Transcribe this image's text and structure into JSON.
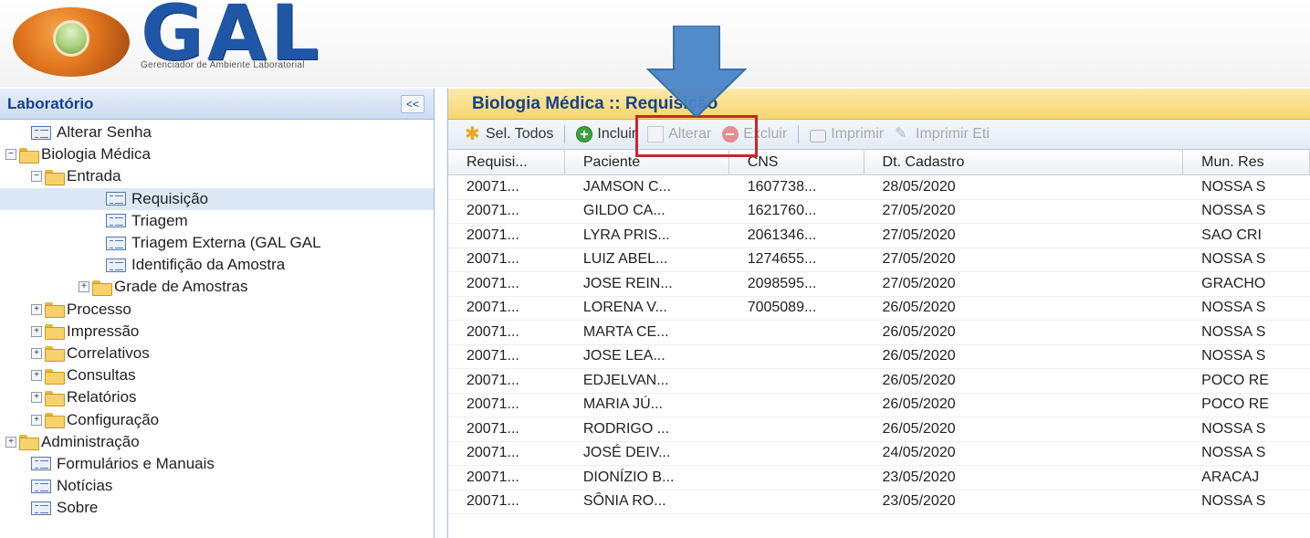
{
  "app": {
    "logo_text": "GAL",
    "logo_subtitle": "Gerenciador de Ambiente Laboratorial"
  },
  "sidebar": {
    "title": "Laboratório",
    "collapse_label": "<<",
    "items": [
      {
        "label": "Alterar Senha",
        "level": 1,
        "type": "leaf"
      },
      {
        "label": "Biologia Médica",
        "level": 0,
        "type": "folder",
        "expanded": true
      },
      {
        "label": "Entrada",
        "level": 1,
        "type": "folder",
        "expanded": true
      },
      {
        "label": "Requisição",
        "level": 3,
        "type": "leaf",
        "selected": true
      },
      {
        "label": "Triagem",
        "level": 3,
        "type": "leaf"
      },
      {
        "label": "Triagem Externa (GAL GAL",
        "level": 3,
        "type": "leaf"
      },
      {
        "label": "Identifição da Amostra",
        "level": 3,
        "type": "leaf"
      },
      {
        "label": "Grade de Amostras",
        "level": 2,
        "type": "folder"
      },
      {
        "label": "Processo",
        "level": 1,
        "type": "folder"
      },
      {
        "label": "Impressão",
        "level": 1,
        "type": "folder"
      },
      {
        "label": "Correlativos",
        "level": 1,
        "type": "folder"
      },
      {
        "label": "Consultas",
        "level": 1,
        "type": "folder"
      },
      {
        "label": "Relatórios",
        "level": 1,
        "type": "folder"
      },
      {
        "label": "Configuração",
        "level": 1,
        "type": "folder"
      },
      {
        "label": "Administração",
        "level": 0,
        "type": "folder"
      },
      {
        "label": "Formulários e Manuais",
        "level": 1,
        "type": "leaf"
      },
      {
        "label": "Notícias",
        "level": 1,
        "type": "leaf"
      },
      {
        "label": "Sobre",
        "level": 1,
        "type": "leaf"
      }
    ]
  },
  "main": {
    "title": "Biologia Médica :: Requisição",
    "toolbar": {
      "select_all": "Sel. Todos",
      "include": "Incluir",
      "edit": "Alterar",
      "delete": "Excluir",
      "print": "Imprimir",
      "print_label": "Imprimir Eti"
    },
    "grid": {
      "columns": [
        "Requisi...",
        "Paciente",
        "CNS",
        "Dt. Cadastro",
        "Mun. Res"
      ],
      "rows": [
        [
          "20071...",
          "JAMSON C...",
          "1607738...",
          "28/05/2020",
          "NOSSA S"
        ],
        [
          "20071...",
          "GILDO CA...",
          "1621760...",
          "27/05/2020",
          "NOSSA S"
        ],
        [
          "20071...",
          "LYRA PRIS...",
          "2061346...",
          "27/05/2020",
          "SAO CRI"
        ],
        [
          "20071...",
          "LUIZ ABEL...",
          "1274655...",
          "27/05/2020",
          "NOSSA S"
        ],
        [
          "20071...",
          "JOSE REIN...",
          "2098595...",
          "27/05/2020",
          "GRACHO"
        ],
        [
          "20071...",
          "LORENA V...",
          "7005089...",
          "26/05/2020",
          "NOSSA S"
        ],
        [
          "20071...",
          "MARTA CE...",
          "",
          "26/05/2020",
          "NOSSA S"
        ],
        [
          "20071...",
          "JOSE LEA...",
          "",
          "26/05/2020",
          "NOSSA S"
        ],
        [
          "20071...",
          "EDJELVAN...",
          "",
          "26/05/2020",
          "POCO RE"
        ],
        [
          "20071...",
          "MARIA JÚ...",
          "",
          "26/05/2020",
          "POCO RE"
        ],
        [
          "20071...",
          "RODRIGO ...",
          "",
          "26/05/2020",
          "NOSSA S"
        ],
        [
          "20071...",
          "JOSÉ DEIV...",
          "",
          "24/05/2020",
          "NOSSA S"
        ],
        [
          "20071...",
          "DIONÍZIO B...",
          "",
          "23/05/2020",
          "ARACAJ"
        ],
        [
          "20071...",
          "SÔNIA RO...",
          "",
          "23/05/2020",
          "NOSSA S"
        ]
      ]
    }
  },
  "annotations": {
    "arrow_color": "#4a86c8",
    "highlight_color": "#c8272b"
  }
}
